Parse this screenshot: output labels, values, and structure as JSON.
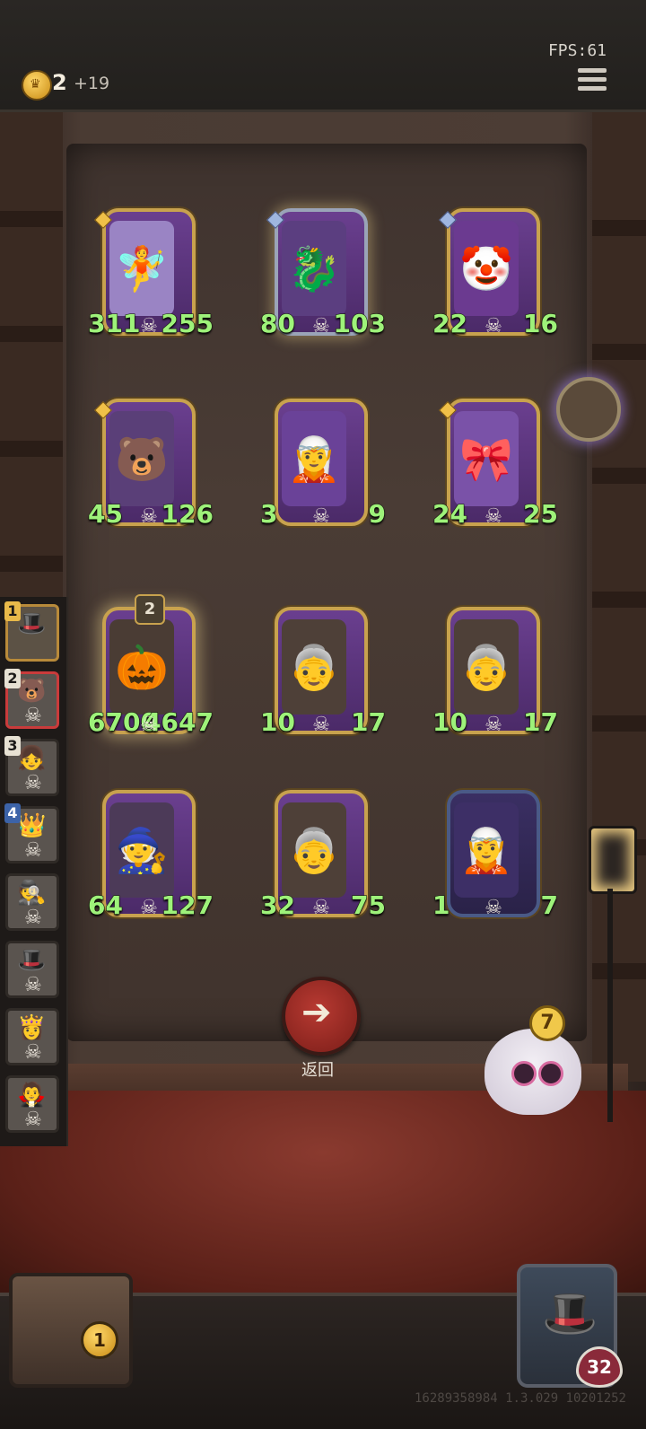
{
  "top_bar": {
    "gold": "2",
    "gold_income": "+19",
    "fps": "FPS:61"
  },
  "board": {
    "cards": [
      {
        "attack": "311",
        "health": "255",
        "portrait_icon": "🧚",
        "portrait_color": "#9a84c4",
        "frame": "gold",
        "gem": "gold"
      },
      {
        "attack": "80",
        "health": "103",
        "portrait_icon": "🐉",
        "portrait_color": "#5b3e80",
        "frame": "silver",
        "gem": "blue"
      },
      {
        "attack": "22",
        "health": "16",
        "portrait_icon": "🤡",
        "portrait_color": "#6b3a90",
        "frame": "gold",
        "gem": "blue"
      },
      {
        "attack": "45",
        "health": "126",
        "portrait_icon": "🐻",
        "portrait_color": "#5a3f78",
        "frame": "gold",
        "gem": "gold"
      },
      {
        "attack": "3",
        "health": "9",
        "portrait_icon": "🧝",
        "portrait_color": "#6a4298",
        "frame": "gold",
        "gem": ""
      },
      {
        "attack": "24",
        "health": "25",
        "portrait_icon": "🎀",
        "portrait_color": "#7a52a8",
        "frame": "gold",
        "gem": "gold"
      },
      {
        "attack": "6700",
        "health": "4647",
        "portrait_icon": "🎃",
        "portrait_color": "#4a3c34",
        "frame": "gold-glow",
        "gem": "",
        "tier": "2"
      },
      {
        "attack": "10",
        "health": "17",
        "portrait_icon": "👵",
        "portrait_color": "#4e4038",
        "frame": "gold",
        "gem": ""
      },
      {
        "attack": "10",
        "health": "17",
        "portrait_icon": "👵",
        "portrait_color": "#4e4038",
        "frame": "gold",
        "gem": ""
      },
      {
        "attack": "64",
        "health": "127",
        "portrait_icon": "🧙",
        "portrait_color": "#4c3a58",
        "frame": "gold",
        "gem": ""
      },
      {
        "attack": "32",
        "health": "75",
        "portrait_icon": "👵",
        "portrait_color": "#4e4038",
        "frame": "gold",
        "gem": ""
      },
      {
        "attack": "1",
        "health": "7",
        "portrait_icon": "🧝",
        "portrait_color": "#3d2f66",
        "frame": "blue",
        "gem": ""
      }
    ]
  },
  "back_button": {
    "label": "返回",
    "icon": "arrow-left-icon"
  },
  "opponents": [
    {
      "rank": "1",
      "style": "first",
      "icon": "🎩"
    },
    {
      "rank": "2",
      "style": "active",
      "icon": "🐻"
    },
    {
      "rank": "3",
      "style": "",
      "icon": "👧"
    },
    {
      "rank": "4",
      "style": "",
      "icon": "👑"
    },
    {
      "rank": "",
      "style": "",
      "icon": "🕵"
    },
    {
      "rank": "",
      "style": "",
      "icon": "🎩"
    },
    {
      "rank": "",
      "style": "",
      "icon": "👸"
    },
    {
      "rank": "",
      "style": "",
      "icon": "🧛"
    }
  ],
  "mascot": {
    "badge": "7"
  },
  "chest": {
    "count": "1"
  },
  "hero": {
    "health": "32"
  },
  "build_id": "16289358984 1.3.029 10201252"
}
